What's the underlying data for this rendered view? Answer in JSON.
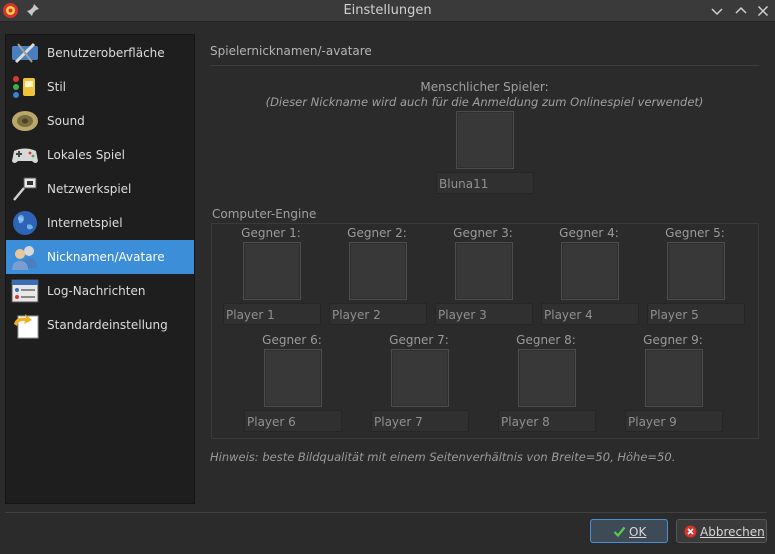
{
  "window": {
    "title": "Einstellungen"
  },
  "sidebar": {
    "items": [
      {
        "label": "Benutzeroberfläche",
        "icon": "tools-icon"
      },
      {
        "label": "Stil",
        "icon": "paint-icon"
      },
      {
        "label": "Sound",
        "icon": "speaker-icon"
      },
      {
        "label": "Lokales Spiel",
        "icon": "gamepad-icon"
      },
      {
        "label": "Netzwerkspiel",
        "icon": "network-icon"
      },
      {
        "label": "Internetspiel",
        "icon": "globe-icon"
      },
      {
        "label": "Nicknamen/Avatare",
        "icon": "users-icon",
        "selected": true
      },
      {
        "label": "Log-Nachrichten",
        "icon": "log-icon"
      },
      {
        "label": "Standardeinstellung",
        "icon": "reset-icon"
      }
    ]
  },
  "main": {
    "section_title": "Spielernicknamen/-avatare",
    "human": {
      "label": "Menschlicher Spieler:",
      "note": "(Dieser Nickname wird auch für die Anmeldung zum Onlinespiel verwendet)",
      "nickname": "Bluna11"
    },
    "engine": {
      "title": "Computer-Engine",
      "opponents": [
        {
          "label": "Gegner 1:",
          "name": "Player 1"
        },
        {
          "label": "Gegner 2:",
          "name": "Player 2"
        },
        {
          "label": "Gegner 3:",
          "name": "Player 3"
        },
        {
          "label": "Gegner 4:",
          "name": "Player 4"
        },
        {
          "label": "Gegner 5:",
          "name": "Player 5"
        },
        {
          "label": "Gegner 6:",
          "name": "Player 6"
        },
        {
          "label": "Gegner 7:",
          "name": "Player 7"
        },
        {
          "label": "Gegner 8:",
          "name": "Player 8"
        },
        {
          "label": "Gegner 9:",
          "name": "Player 9"
        }
      ]
    },
    "hint": "Hinweis: beste Bildqualität mit einem Seitenverhältnis von Breite=50, Höhe=50."
  },
  "buttons": {
    "ok": "OK",
    "cancel": "Abbrechen"
  },
  "colors": {
    "accent": "#3c8ed8",
    "background": "#2b2b2b",
    "sidebar": "#1e1e1e"
  }
}
